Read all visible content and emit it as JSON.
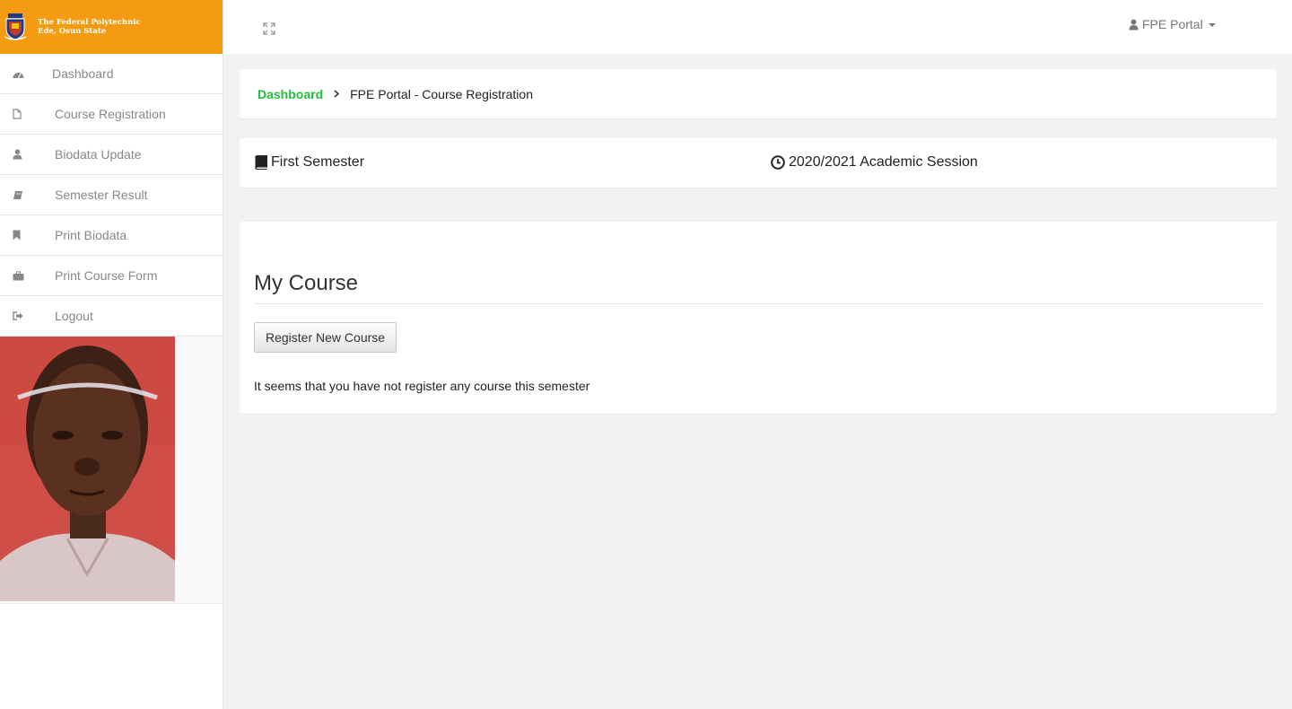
{
  "brand": {
    "line1": "The Federal Polytechnic",
    "line2": "Ede, Osun State",
    "color": "#f39c12"
  },
  "sidebar": {
    "items": [
      {
        "label": "Dashboard",
        "icon": "dashboard-icon"
      },
      {
        "label": "Course Registration",
        "icon": "file-icon"
      },
      {
        "label": "Biodata Update",
        "icon": "user-icon"
      },
      {
        "label": "Semester Result",
        "icon": "book-icon"
      },
      {
        "label": "Print Biodata",
        "icon": "bookmark-icon"
      },
      {
        "label": "Print Course Form",
        "icon": "briefcase-icon"
      },
      {
        "label": "Logout",
        "icon": "sign-out-icon"
      }
    ]
  },
  "topbar": {
    "user_label": "FPE Portal"
  },
  "breadcrumb": {
    "home": "Dashboard",
    "current": "FPE Portal - Course Registration",
    "link_color": "#1fbf3a"
  },
  "info": {
    "semester": "First Semester",
    "session": "2020/2021 Academic Session"
  },
  "course": {
    "title": "My Course",
    "button_label": "Register New Course",
    "empty_message": "It seems that you have not register any course this semester"
  }
}
